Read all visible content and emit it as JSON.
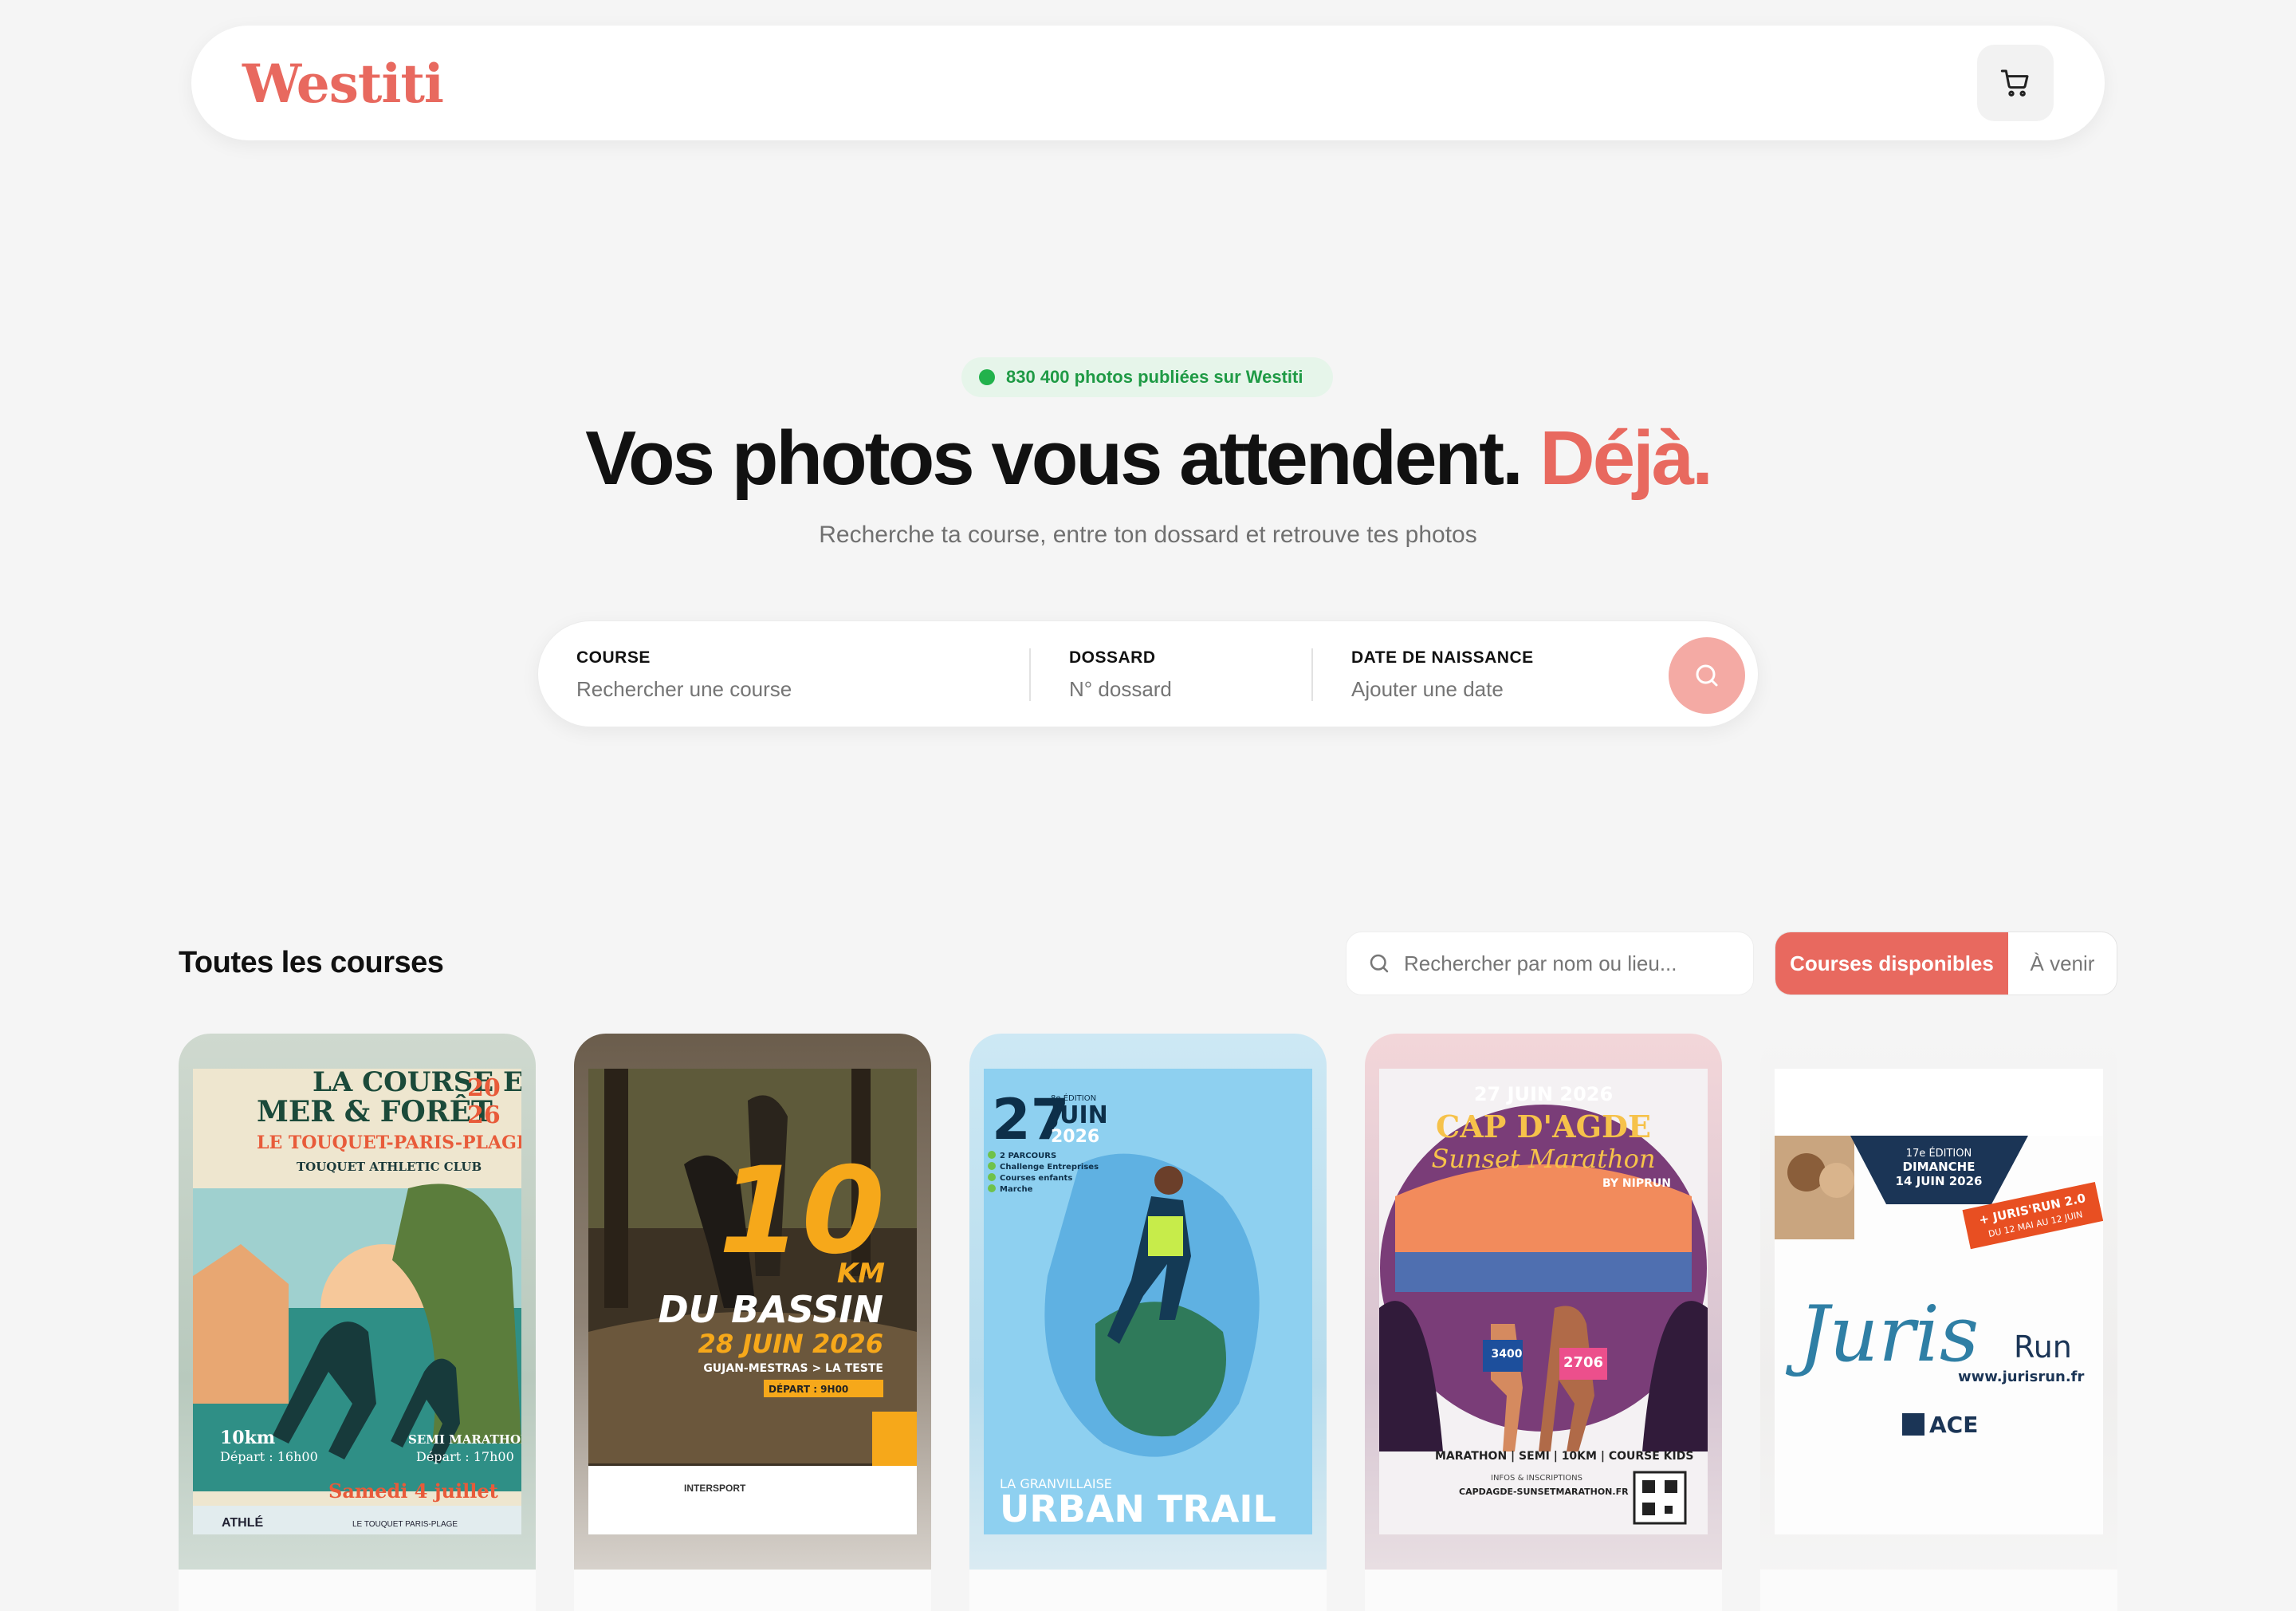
{
  "header": {
    "logo": "Westiti",
    "cart_icon": "cart-icon"
  },
  "hero": {
    "badge": "830 400 photos publiées sur Westiti",
    "title_main": "Vos photos vous attendent.",
    "title_accent": "Déjà.",
    "subtitle": "Recherche ta course, entre ton dossard et retrouve tes photos"
  },
  "search": {
    "course_label": "COURSE",
    "course_placeholder": "Rechercher une course",
    "dossard_label": "DOSSARD",
    "dossard_placeholder": "N° dossard",
    "date_label": "DATE DE NAISSANCE",
    "date_placeholder": "Ajouter une date"
  },
  "courses": {
    "title": "Toutes les courses",
    "search_placeholder": "Rechercher par nom ou lieu...",
    "tab_available": "Courses disponibles",
    "tab_upcoming": "À venir"
  },
  "cards": [
    {
      "l1": "LA COURSE ENTRE",
      "l2": "MER & FORÊT",
      "year1": "20",
      "year2": "26",
      "place": "LE TOUQUET-PARIS-PLAGE",
      "club": "TOUQUET ATHLETIC CLUB",
      "dist1": "10km",
      "dep1": "Départ : 16h00",
      "dist2": "SEMI MARATHON",
      "dep2": "Départ : 17h00",
      "date": "Samedi 4 juillet",
      "sponsor1": "ATHLÉ",
      "sponsor2": "LE TOUQUET PARIS-PLAGE"
    },
    {
      "big": "10",
      "km": "KM",
      "name": "DU BASSIN",
      "date": "28 JUIN 2026",
      "route": "GUJAN-MESTRAS > LA TESTE",
      "depart": "DÉPART : 9H00",
      "sponsor": "INTERSPORT"
    },
    {
      "day": "27",
      "month": "JUIN",
      "edition": "8e ÉDITION",
      "year": "2026",
      "items": [
        "2 PARCOURS",
        "Challenge Entreprises",
        "Courses enfants",
        "Marche"
      ],
      "subtitle": "LA GRANVILLAISE",
      "title": "URBAN TRAIL"
    },
    {
      "date": "27 JUIN 2026",
      "name1": "CAP D'AGDE",
      "name2": "Sunset Marathon",
      "by": "BY NIPRUN",
      "bib1": "3400",
      "bib2": "2706",
      "types": "MARATHON | SEMI | 10KM | COURSE KIDS",
      "info": "INFOS & INSCRIPTIONS",
      "site": "CAPDAGDE-SUNSETMARATHON.FR"
    },
    {
      "edition": "17e ÉDITION",
      "day": "DIMANCHE",
      "date": "14 JUIN 2026",
      "promo1": "+ JURIS'RUN 2.0",
      "promo2": "DU 12 MAI AU 12 JUIN",
      "brand1": "Juris",
      "brand2": "Run",
      "site": "www.jurisrun.fr",
      "org": "ACE"
    }
  ],
  "colors": {
    "accent": "#e8695f",
    "badge_green": "#1f9a45"
  }
}
